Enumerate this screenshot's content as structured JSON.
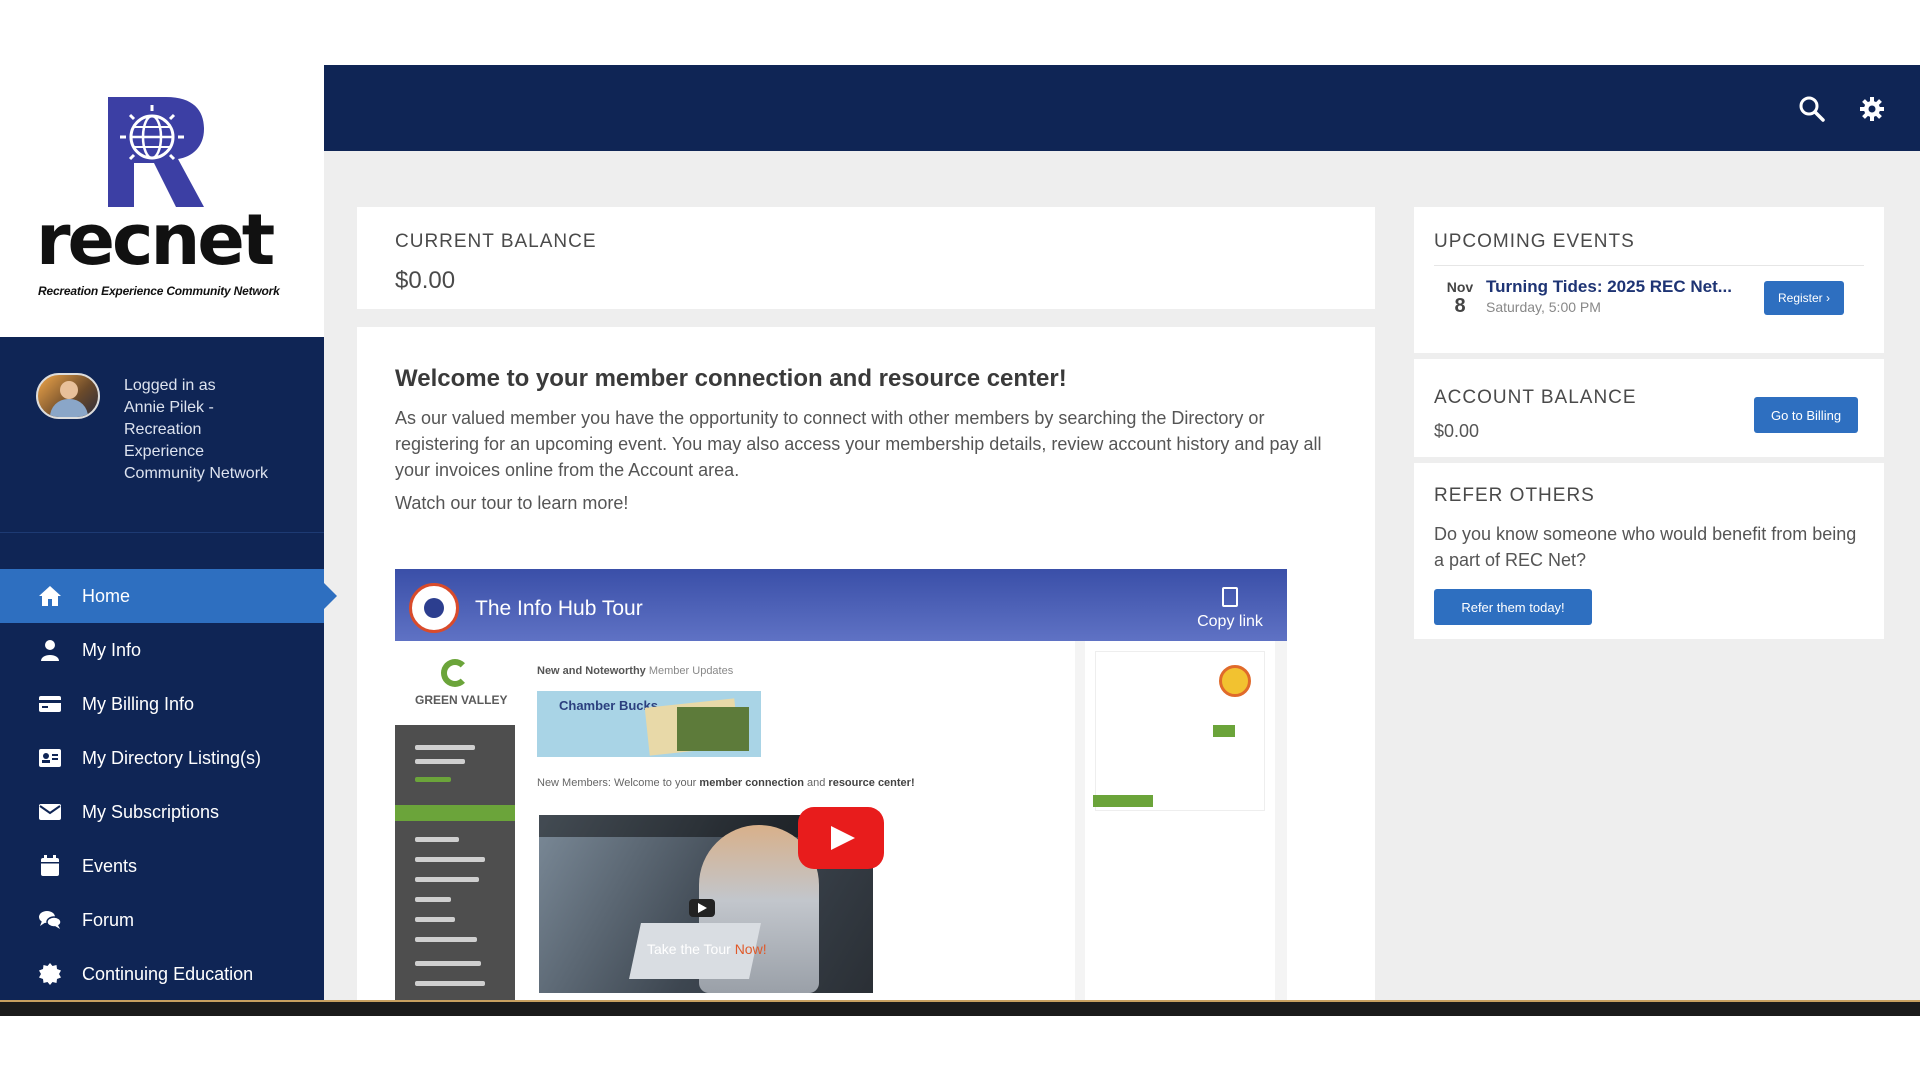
{
  "brand": {
    "logo_letter": "R",
    "logo_word": "recnet",
    "tagline": "Recreation Experience Community Network",
    "accent_color": "#2e6fc0",
    "navy_color": "#0f2555"
  },
  "user": {
    "logged_in_text": "Logged in as\nAnnie Pilek -\nRecreation\nExperience\nCommunity Network"
  },
  "nav": {
    "items": [
      {
        "label": "Home",
        "icon": "home-icon",
        "active": true
      },
      {
        "label": "My Info",
        "icon": "user-icon"
      },
      {
        "label": "My Billing Info",
        "icon": "credit-card-icon"
      },
      {
        "label": "My Directory Listing(s)",
        "icon": "id-card-icon"
      },
      {
        "label": "My Subscriptions",
        "icon": "envelope-icon"
      },
      {
        "label": "Events",
        "icon": "calendar-icon"
      },
      {
        "label": "Forum",
        "icon": "chat-bubbles-icon"
      },
      {
        "label": "Continuing Education",
        "icon": "certificate-icon"
      }
    ]
  },
  "topbar": {
    "icons": [
      "search-icon",
      "gear-icon"
    ]
  },
  "balance": {
    "heading": "CURRENT BALANCE",
    "value": "$0.00"
  },
  "welcome": {
    "title": "Welcome to your member connection and resource center!",
    "body": "As our valued member you have the opportunity to connect with other members by searching the Directory or registering for an upcoming event. You may also access your membership details, review account history and pay all your invoices online from the Account area.",
    "tour_text": "Watch our tour to learn more!"
  },
  "video": {
    "title": "The Info Hub Tour",
    "copy_label": "Copy link",
    "screen_logo": "GREEN VALLEY",
    "screen_heading_bold": "New and Noteworthy",
    "screen_heading_light": " Member Updates",
    "screen_banner": "Chamber Bucks",
    "screen_new_members": "New Members: Welcome to your",
    "screen_new_members_bold": " member connection",
    "screen_new_members_and": " and",
    "screen_new_members_bold2": " resource center!",
    "caption_prefix": "Take the Tour ",
    "caption_highlight": "Now!"
  },
  "events": {
    "heading": "UPCOMING EVENTS",
    "items": [
      {
        "month": "Nov",
        "day": "8",
        "title": "Turning Tides: 2025 REC Net...",
        "time": "Saturday, 5:00 PM",
        "button": "Register ›"
      }
    ]
  },
  "account": {
    "heading": "ACCOUNT BALANCE",
    "value": "$0.00",
    "button": "Go to Billing"
  },
  "refer": {
    "heading": "REFER OTHERS",
    "text": "Do you know someone who would benefit from being a part of REC Net?",
    "button": "Refer them today!"
  }
}
